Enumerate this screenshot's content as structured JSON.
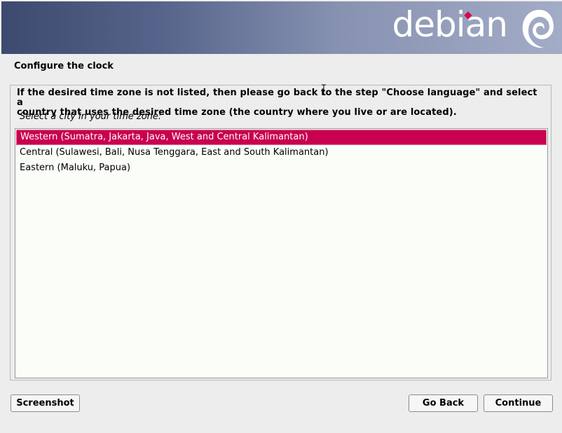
{
  "brand": {
    "name": "debian",
    "accent_color": "#d70751"
  },
  "page": {
    "title": "Configure the clock",
    "info_line1": "If the desired time zone is not listed, then please go back to the step \"Choose language\" and select a",
    "info_line2": "country that uses the desired time zone (the country where you live or are located).",
    "prompt": "Select a city in your time zone:"
  },
  "timezones": {
    "selected_index": 0,
    "items": [
      {
        "label": "Western (Sumatra, Jakarta, Java, West and Central Kalimantan)"
      },
      {
        "label": "Central (Sulawesi, Bali, Nusa Tenggara, East and South Kalimantan)"
      },
      {
        "label": "Eastern (Maluku, Papua)"
      }
    ]
  },
  "buttons": {
    "screenshot": "Screenshot",
    "go_back": "Go Back",
    "continue": "Continue"
  },
  "colors": {
    "selection": "#c8004f",
    "list_background": "#fbfdf9"
  }
}
